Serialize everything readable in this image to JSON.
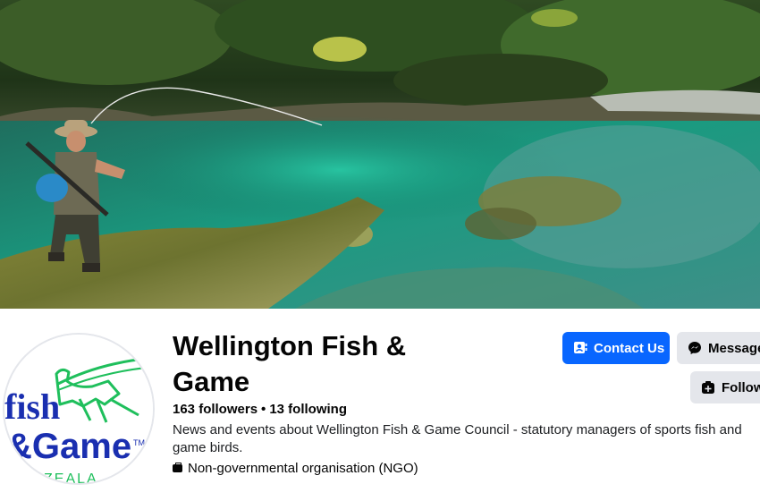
{
  "page": {
    "name": "Wellington Fish & Game",
    "followers_text": "163 followers",
    "separator": "•",
    "following_text": "13 following",
    "description": "News and events about Wellington Fish & Game Council - statutory managers of sports fish and game birds.",
    "category": "Non-governmental organisation (NGO)"
  },
  "buttons": {
    "contact_label": "Contact Us",
    "message_label": "Message",
    "follow_label": "Follow"
  },
  "logo": {
    "line1": "fish",
    "line2": "&Game",
    "tm": "TM",
    "bottom": "ZEALA"
  },
  "icons": {
    "contact": "contact-card-icon",
    "message": "messenger-icon",
    "follow": "follow-plus-icon",
    "category": "briefcase-icon"
  },
  "colors": {
    "primary_button": "#0866ff",
    "secondary_button": "#e4e6eb",
    "logo_green": "#1fbf5c",
    "logo_blue": "#1a2fb0"
  }
}
